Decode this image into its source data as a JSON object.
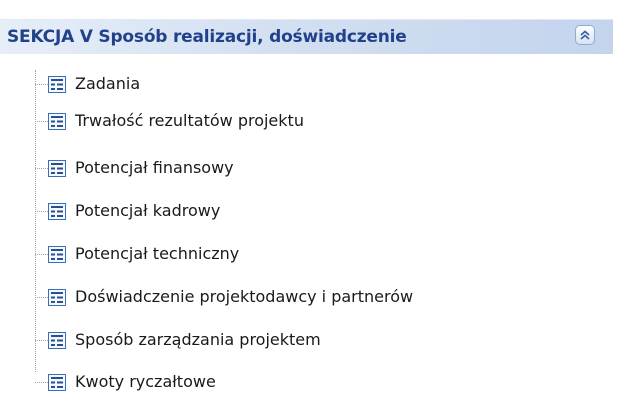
{
  "section": {
    "title": "SEKCJA V Sposób realizacji, doświadczenie",
    "collapse_icon": "double-chevron-up-icon"
  },
  "tree": {
    "item_icon": "form-icon",
    "items": [
      {
        "label": "Zadania"
      },
      {
        "label": "Trwałość rezultatów projektu"
      },
      {
        "label": "Potencjał finansowy"
      },
      {
        "label": "Potencjał kadrowy"
      },
      {
        "label": "Potencjał techniczny"
      },
      {
        "label": "Doświadczenie projektodawcy i partnerów"
      },
      {
        "label": "Sposób zarządzania projektem"
      },
      {
        "label": "Kwoty ryczałtowe"
      }
    ]
  },
  "colors": {
    "header_text": "#21428a",
    "header_gradient_start": "#e6eef8",
    "header_gradient_end": "#c4d4ed",
    "icon_border": "#3a6fb7"
  }
}
